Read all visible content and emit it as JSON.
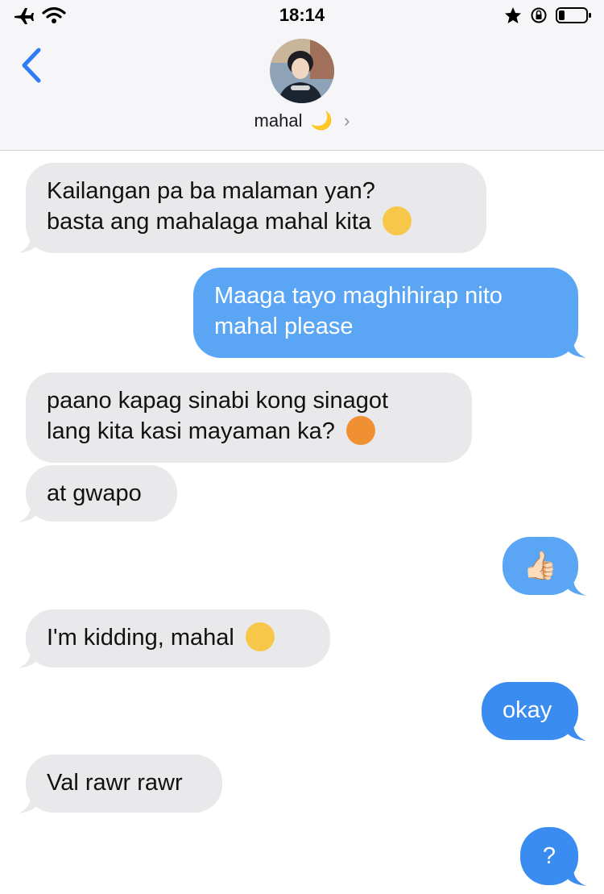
{
  "status_bar": {
    "time": "18:14"
  },
  "contact": {
    "name": "mahal",
    "name_emoji": "🌙",
    "chevron": "›"
  },
  "messages": [
    {
      "side": "in",
      "lines": [
        "Kailangan pa ba malaman yan?",
        "basta ang mahalaga mahal kita"
      ],
      "emoji": "☺️"
    },
    {
      "side": "out",
      "lines": [
        "Maaga tayo maghihirap nito",
        "mahal please"
      ]
    },
    {
      "side": "in",
      "lines": [
        "paano kapag sinabi kong sinagot",
        "lang kita kasi mayaman ka?"
      ],
      "emoji": "😠"
    },
    {
      "side": "in",
      "lines": [
        "at gwapo"
      ]
    },
    {
      "side": "out",
      "lines": [
        "👍🏻"
      ]
    },
    {
      "side": "in",
      "lines": [
        "I'm kidding, mahal"
      ],
      "emoji": "☺️"
    },
    {
      "side": "out",
      "lines": [
        "okay"
      ]
    },
    {
      "side": "in",
      "lines": [
        "Val rawr rawr"
      ]
    },
    {
      "side": "out",
      "lines": [
        "?"
      ]
    }
  ],
  "colors": {
    "incoming": "#e9e9eb",
    "outgoing": "#5aa6f5",
    "accent": "#3a8cf0"
  }
}
